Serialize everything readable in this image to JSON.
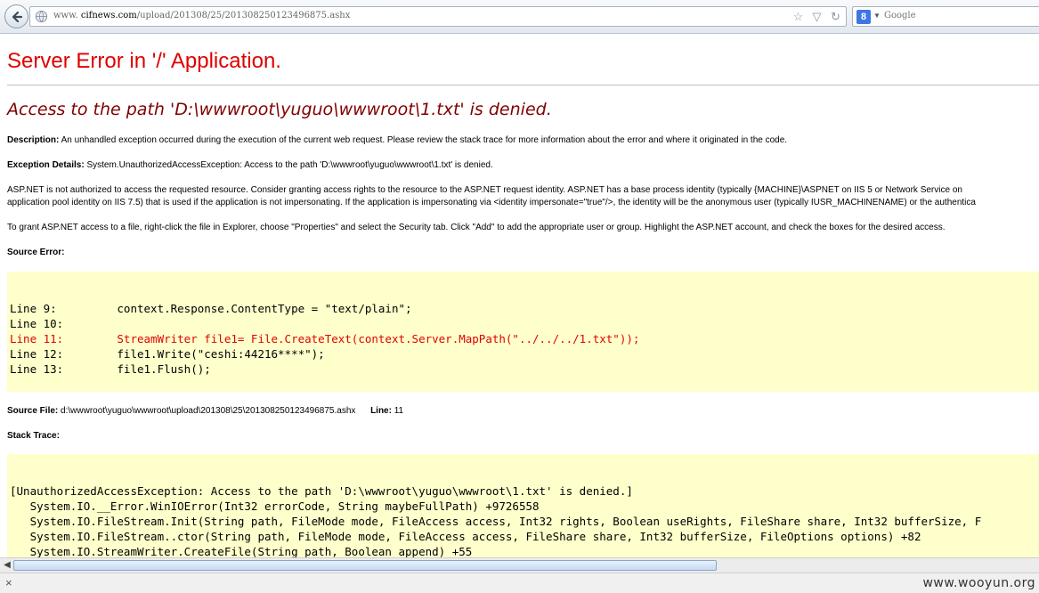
{
  "browser": {
    "url_prefix": "www.",
    "url_host": "cifnews.com",
    "url_path": "/upload/201308/25/201308250123496875.ashx",
    "search_engine_icon": "8",
    "search_placeholder": "Google"
  },
  "page": {
    "title": "Server Error in '/' Application.",
    "error_message": "Access to the path 'D:\\wwwroot\\yuguo\\wwwroot\\1.txt' is denied.",
    "description_label": "Description:",
    "description_text": "An unhandled exception occurred during the execution of the current web request. Please review the stack trace for more information about the error and where it originated in the code.",
    "exception_label": "Exception Details:",
    "exception_text": "System.UnauthorizedAccessException: Access to the path 'D:\\wwwroot\\yuguo\\wwwroot\\1.txt' is denied.",
    "aspnet_line1": "ASP.NET is not authorized to access the requested resource. Consider granting access rights to the resource to the ASP.NET request identity. ASP.NET has a base process identity (typically {MACHINE}\\ASPNET on IIS 5 or Network Service on",
    "aspnet_line2": "application pool identity on IIS 7.5) that is used if the application is not impersonating. If the application is impersonating via <identity impersonate=\"true\"/>, the identity will be the anonymous user (typically IUSR_MACHINENAME) or the authentica",
    "grant_text": "To grant ASP.NET access to a file, right-click the file in Explorer, choose \"Properties\" and select the Security tab. Click \"Add\" to add the appropriate user or group. Highlight the ASP.NET account, and check the boxes for the desired access.",
    "source_error_label": "Source Error:",
    "source_lines": [
      "Line 9:         context.Response.ContentType = \"text/plain\";",
      "Line 10:",
      "Line 11:        StreamWriter file1= File.CreateText(context.Server.MapPath(\"../../../1.txt\"));",
      "Line 12:        file1.Write(\"ceshi:44216****\");",
      "Line 13:        file1.Flush();"
    ],
    "highlight_line_index": 2,
    "source_file_label": "Source File:",
    "source_file_path": "d:\\wwwroot\\yuguo\\wwwroot\\upload\\201308\\25\\201308250123496875.ashx",
    "line_label": "Line:",
    "line_number": "11",
    "stack_trace_label": "Stack Trace:",
    "stack_lines": [
      "[UnauthorizedAccessException: Access to the path 'D:\\wwwroot\\yuguo\\wwwroot\\1.txt' is denied.]",
      "   System.IO.__Error.WinIOError(Int32 errorCode, String maybeFullPath) +9726558",
      "   System.IO.FileStream.Init(String path, FileMode mode, FileAccess access, Int32 rights, Boolean useRights, FileShare share, Int32 bufferSize, F",
      "   System.IO.FileStream..ctor(String path, FileMode mode, FileAccess access, FileShare share, Int32 bufferSize, FileOptions options) +82",
      "   System.IO.StreamWriter.CreateFile(String path, Boolean append) +55"
    ]
  },
  "statusbar": {
    "watermark": "www.wooyun.org"
  },
  "colors": {
    "title_red": "#e00000",
    "error_maroon": "#800000",
    "code_bg": "#ffffcc"
  }
}
